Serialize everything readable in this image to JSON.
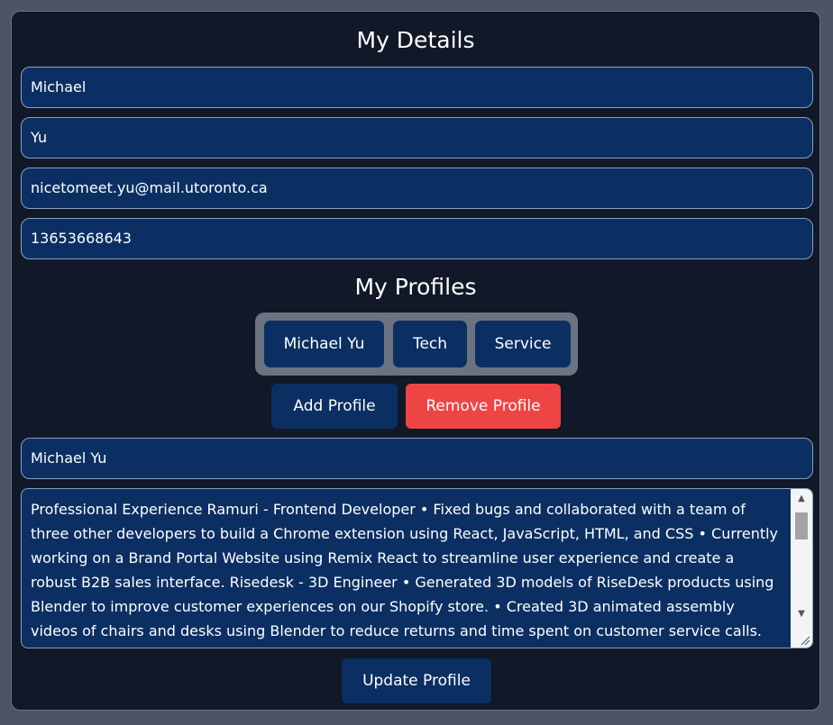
{
  "details": {
    "title": "My Details",
    "first_name": "Michael",
    "last_name": "Yu",
    "email": "nicetomeet.yu@mail.utoronto.ca",
    "phone": "13653668643"
  },
  "profiles": {
    "title": "My Profiles",
    "tabs": [
      {
        "label": "Michael Yu"
      },
      {
        "label": "Tech"
      },
      {
        "label": "Service"
      }
    ],
    "add_label": "Add Profile",
    "remove_label": "Remove Profile",
    "profile_name": "Michael Yu",
    "profile_text": "Professional Experience Ramuri - Frontend Developer •  Fixed bugs and collaborated with a team of three other developers to build a Chrome extension using React, JavaScript, HTML, and CSS •   Currently working on a Brand Portal Website using Remix React to streamline user experience and create a robust B2B sales interface. Risedesk - 3D Engineer •   Generated 3D models of RiseDesk products using Blender to improve customer experiences on our Shopify store. •   Created 3D animated assembly videos of chairs and desks using Blender to reduce returns and time spent on customer service calls. Cocurricular",
    "update_label": "Update Profile"
  },
  "colors": {
    "page_bg": "#4b5563",
    "panel_bg": "#111827",
    "field_bg": "#0b2f62",
    "danger": "#ef4444",
    "tray": "#6b7280"
  }
}
